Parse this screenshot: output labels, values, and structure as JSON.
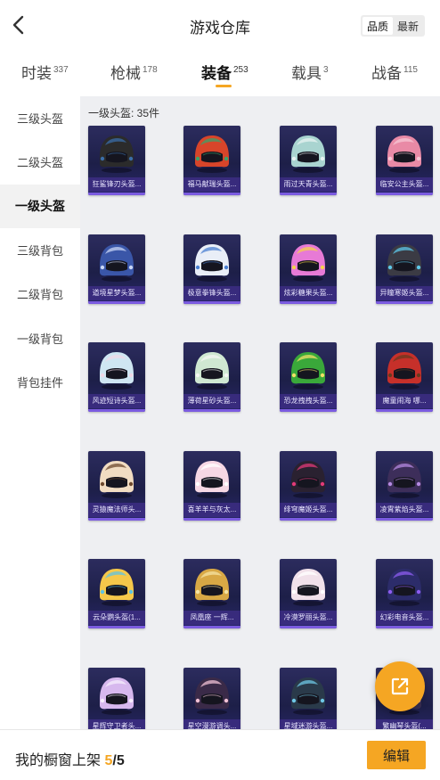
{
  "header": {
    "title": "游戏仓库",
    "back_icon": "chevron-left-icon",
    "sort_options": [
      {
        "label": "品质",
        "active": true
      },
      {
        "label": "最新",
        "active": false
      }
    ]
  },
  "tabs": [
    {
      "label": "时装",
      "count": "337",
      "active": false
    },
    {
      "label": "枪械",
      "count": "178",
      "active": false
    },
    {
      "label": "装备",
      "count": "253",
      "active": true
    },
    {
      "label": "载具",
      "count": "3",
      "active": false
    },
    {
      "label": "战备",
      "count": "115",
      "active": false
    }
  ],
  "sidebar": {
    "items": [
      {
        "label": "三级头盔",
        "active": false
      },
      {
        "label": "二级头盔",
        "active": false
      },
      {
        "label": "一级头盔",
        "active": true
      },
      {
        "label": "三级背包",
        "active": false
      },
      {
        "label": "二级背包",
        "active": false
      },
      {
        "label": "一级背包",
        "active": false
      },
      {
        "label": "背包挂件",
        "active": false
      }
    ]
  },
  "content": {
    "count_label": "一级头盔: 35件",
    "items": [
      {
        "name": "狂鲨锋刃头盔...",
        "color": "#2b2b2b",
        "accent": "#3b6ea8"
      },
      {
        "name": "福马献瑞头盔...",
        "color": "#d8452a",
        "accent": "#3aa36b"
      },
      {
        "name": "雨过天青头盔...",
        "color": "#a9d4d0",
        "accent": "#e8f3f2"
      },
      {
        "name": "临安公主头盔...",
        "color": "#e98aa6",
        "accent": "#f6c7d4"
      },
      {
        "name": "道境星梦头盔...",
        "color": "#3a56a8",
        "accent": "#c9d6f5"
      },
      {
        "name": "极意拳锋头盔...",
        "color": "#e9eef7",
        "accent": "#4a7fd1"
      },
      {
        "name": "炫彩糖果头盔...",
        "color": "#e77ad6",
        "accent": "#f5d34a"
      },
      {
        "name": "异瞳寒姬头盔...",
        "color": "#3b3b44",
        "accent": "#5ec8e8"
      },
      {
        "name": "风迹短诗头盔...",
        "color": "#cfe6f2",
        "accent": "#f0d8e6"
      },
      {
        "name": "薄荷星砂头盔...",
        "color": "#cfe8d2",
        "accent": "#f4f7f3"
      },
      {
        "name": "恐龙拽拽头盔...",
        "color": "#3aa83a",
        "accent": "#f2e066"
      },
      {
        "name": "魔童闹海 哪...",
        "color": "#c6302a",
        "accent": "#6a3a1f"
      },
      {
        "name": "灵猿魔法师头...",
        "color": "#f1dcc2",
        "accent": "#6e4a2e"
      },
      {
        "name": "喜羊羊与灰太...",
        "color": "#f6d7e4",
        "accent": "#ffffff"
      },
      {
        "name": "绯穹魔姬头盔...",
        "color": "#2a2130",
        "accent": "#e23a78"
      },
      {
        "name": "凌霄紫焰头盔...",
        "color": "#3d2e5a",
        "accent": "#b58ae2"
      },
      {
        "name": "云朵鹦头盔(1...",
        "color": "#f5c84a",
        "accent": "#5ec3e3"
      },
      {
        "name": "凤凰座 一辉...",
        "color": "#d8a845",
        "accent": "#f5e3a3"
      },
      {
        "name": "冷漠罗丽头盔...",
        "color": "#f1e1ea",
        "accent": "#ffffff"
      },
      {
        "name": "幻彩电音头盔...",
        "color": "#2c2c6a",
        "accent": "#8e5cf0"
      },
      {
        "name": "星辉守卫者头...",
        "color": "#d7b8ee",
        "accent": "#f6eefc"
      },
      {
        "name": "星空漫游调头...",
        "color": "#3a2a48",
        "accent": "#f2c2d6"
      },
      {
        "name": "星域迷游头盔...",
        "color": "#2a3a4a",
        "accent": "#6fc8e6"
      },
      {
        "name": "繁幽琴头盔(...",
        "color": "#3a3055",
        "accent": "#e8a2c6"
      }
    ]
  },
  "fab": {
    "icon": "share-external-icon",
    "color": "#f5a623"
  },
  "footer": {
    "shelf_label": "我的橱窗上架",
    "shelf_count": "5",
    "shelf_total": "/5",
    "edit_label": "编辑"
  },
  "colors": {
    "accent": "#f5a623",
    "panel_bg": "#eeeff2",
    "card_bg": "#1d1f48"
  }
}
